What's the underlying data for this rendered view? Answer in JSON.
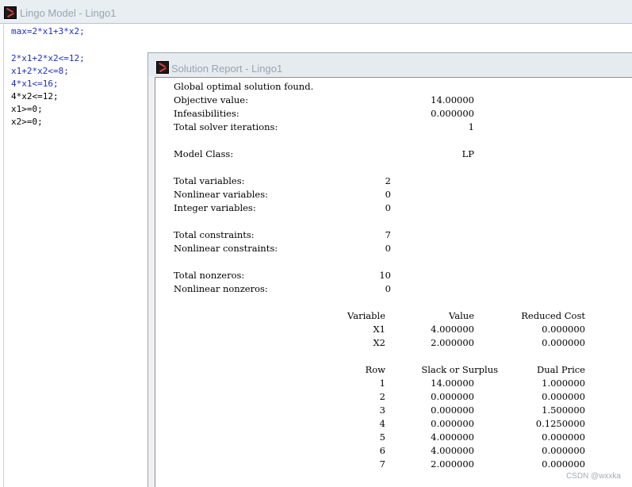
{
  "model_window": {
    "title": "Lingo Model - Lingo1",
    "code_lines": [
      {
        "text": "max=2*x1+3*x2;",
        "color": "#1f2fc6"
      },
      {
        "text": "",
        "color": "#000000"
      },
      {
        "text": "2*x1+2*x2<=12;",
        "color": "#1f2fc6"
      },
      {
        "text": "x1+2*x2<=8;",
        "color": "#1f2fc6"
      },
      {
        "text": "4*x1<=16;",
        "color": "#1f2fc6"
      },
      {
        "text": "4*x2<=12;",
        "color": "#000000"
      },
      {
        "text": "x1>=0;",
        "color": "#000000"
      },
      {
        "text": "x2>=0;",
        "color": "#000000"
      }
    ]
  },
  "report_window": {
    "title": "Solution Report - Lingo1",
    "status": "Global optimal solution found.",
    "summary": [
      {
        "label": "Objective value:",
        "value": "14.00000"
      },
      {
        "label": "Infeasibilities:",
        "value": "0.000000"
      },
      {
        "label": "Total solver iterations:",
        "value": "1"
      }
    ],
    "model_class": {
      "label": "Model Class:",
      "value": "LP"
    },
    "variables_info": [
      {
        "label": "Total variables:",
        "value": "2"
      },
      {
        "label": "Nonlinear variables:",
        "value": "0"
      },
      {
        "label": "Integer variables:",
        "value": "0"
      }
    ],
    "constraints_info": [
      {
        "label": "Total constraints:",
        "value": "7"
      },
      {
        "label": "Nonlinear constraints:",
        "value": "0"
      }
    ],
    "nonzeros_info": [
      {
        "label": "Total nonzeros:",
        "value": "10"
      },
      {
        "label": "Nonlinear nonzeros:",
        "value": "0"
      }
    ],
    "variable_table": {
      "headers": [
        "Variable",
        "Value",
        "Reduced Cost"
      ],
      "rows": [
        [
          "X1",
          "4.000000",
          "0.000000"
        ],
        [
          "X2",
          "2.000000",
          "0.000000"
        ]
      ]
    },
    "row_table": {
      "headers": [
        "Row",
        "Slack or Surplus",
        "Dual Price"
      ],
      "rows": [
        [
          "1",
          "14.00000",
          "1.000000"
        ],
        [
          "2",
          "0.000000",
          "0.000000"
        ],
        [
          "3",
          "0.000000",
          "1.500000"
        ],
        [
          "4",
          "0.000000",
          "0.1250000"
        ],
        [
          "5",
          "4.000000",
          "0.000000"
        ],
        [
          "6",
          "4.000000",
          "0.000000"
        ],
        [
          "7",
          "2.000000",
          "0.000000"
        ]
      ]
    }
  },
  "watermark": "CSDN @wxxka",
  "colors": {
    "keyword_blue": "#1f2fc6",
    "titlebar_inactive": "#e9eef3",
    "title_text_inactive": "#9aa4ae"
  },
  "icons": {
    "app": "lingo-app-icon"
  }
}
